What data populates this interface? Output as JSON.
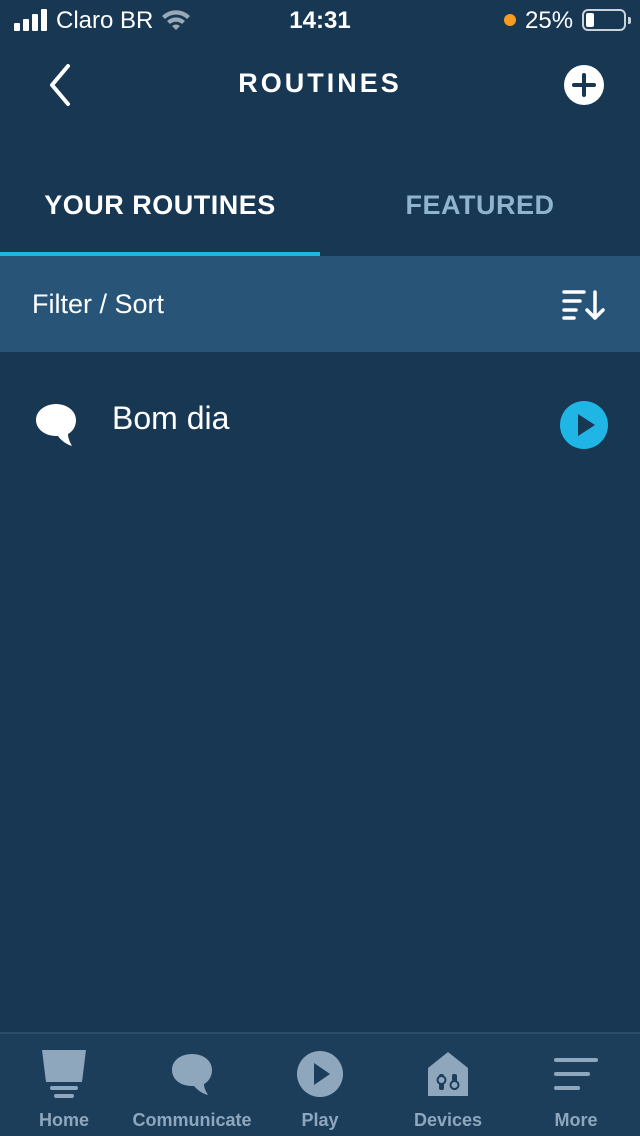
{
  "status_bar": {
    "carrier": "Claro BR",
    "time": "14:31",
    "battery": "25%",
    "signal_bars": 4,
    "battery_level": 0.25
  },
  "header": {
    "title": "ROUTINES",
    "back_icon": "chevron-left-icon",
    "add_icon": "plus-circle-icon"
  },
  "tabs": [
    {
      "label": "YOUR ROUTINES",
      "active": true
    },
    {
      "label": "FEATURED",
      "active": false
    }
  ],
  "filter": {
    "label": "Filter / Sort",
    "icon": "sort-icon"
  },
  "routines": [
    {
      "name": "Bom dia",
      "icon": "speech-bubble-icon",
      "action_icon": "play-icon"
    }
  ],
  "bottom_nav": [
    {
      "label": "Home",
      "icon": "home-icon"
    },
    {
      "label": "Communicate",
      "icon": "chat-bubble-icon"
    },
    {
      "label": "Play",
      "icon": "play-icon"
    },
    {
      "label": "Devices",
      "icon": "devices-icon"
    },
    {
      "label": "More",
      "icon": "menu-icon"
    }
  ],
  "colors": {
    "background": "#173753",
    "filter_bar": "#285577",
    "accent": "#1fb6e6",
    "inactive_tab": "#8fb4cc",
    "nav_inactive": "#8ea7bd",
    "battery_dot": "#f39c1f"
  }
}
